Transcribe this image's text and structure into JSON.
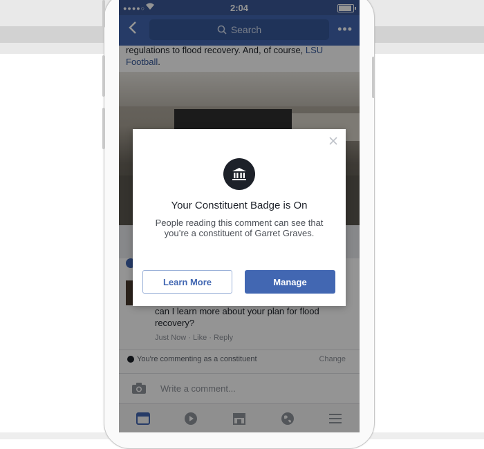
{
  "status_bar": {
    "signal": "●●●●○",
    "time": "2:04"
  },
  "nav": {
    "search_placeholder": "Search",
    "more": "•••"
  },
  "post": {
    "text": "regulations to flood recovery. And, of course, ",
    "link": "LSU Football",
    "text_end": "."
  },
  "comment": {
    "text": "can I learn more about your plan for flood recovery?",
    "time": "Just Now",
    "like": "Like",
    "reply": "Reply",
    "sep": "·"
  },
  "constituent_note": "You're commenting as a constituent",
  "constituent_more": "Change",
  "composer_placeholder": "Write a comment...",
  "dialog": {
    "title": "Your Constituent Badge is On",
    "body": "People reading this comment can see that you’re a constituent of Garret Graves.",
    "learn_more": "Learn More",
    "manage": "Manage"
  },
  "colors": {
    "brand": "#4267b2",
    "statusbar": "#3b5998"
  },
  "icons": [
    "back-arrow-icon",
    "search-icon",
    "more-icon",
    "close-icon",
    "government-building-icon",
    "camera-icon",
    "news-feed-icon",
    "video-icon",
    "marketplace-icon",
    "globe-icon",
    "menu-icon"
  ]
}
